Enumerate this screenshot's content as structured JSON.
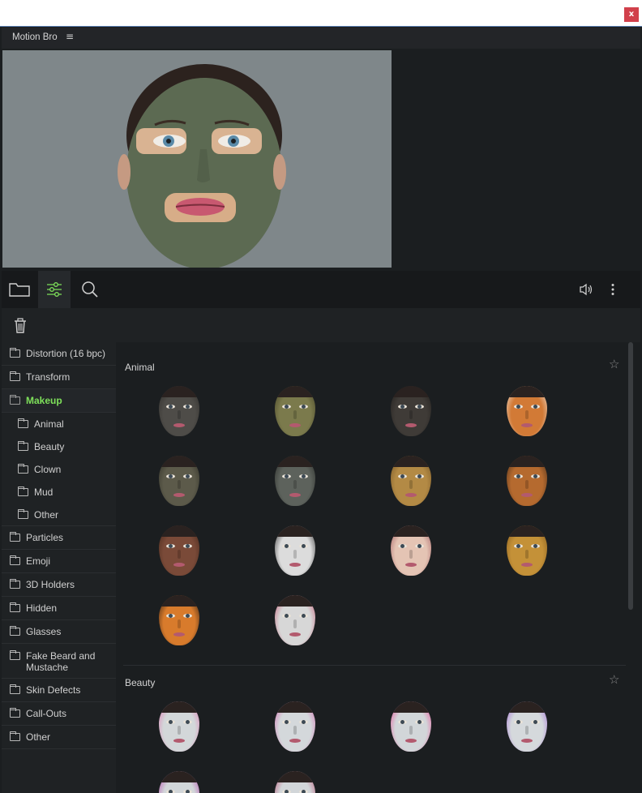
{
  "window": {
    "close_label": "x"
  },
  "panel": {
    "title": "Motion Bro",
    "menu_icon": "hamburger-icon"
  },
  "toolbar": {
    "icons": [
      "folder-icon",
      "sliders-icon",
      "search-icon",
      "speaker-icon",
      "more-vertical-icon"
    ]
  },
  "actionbar": {
    "icon": "trash-icon"
  },
  "sidebar": {
    "items": [
      {
        "label": "Distortion (16 bpc)"
      },
      {
        "label": "Transform"
      },
      {
        "label": "Makeup"
      },
      {
        "label": "Animal"
      },
      {
        "label": "Beauty"
      },
      {
        "label": "Clown"
      },
      {
        "label": "Mud"
      },
      {
        "label": "Other"
      },
      {
        "label": "Particles"
      },
      {
        "label": "Emoji"
      },
      {
        "label": "3D Holders"
      },
      {
        "label": "Hidden"
      },
      {
        "label": "Glasses"
      },
      {
        "label": "Fake Beard and Mustache"
      },
      {
        "label": "Skin Defects"
      },
      {
        "label": "Call-Outs"
      },
      {
        "label": "Other"
      }
    ]
  },
  "sections": [
    {
      "title": "Animal",
      "thumbs": [
        {
          "skin": "#4e4c48",
          "accent": "#2d2b28"
        },
        {
          "skin": "#7b7a4c",
          "accent": "#3f3c22"
        },
        {
          "skin": "#3f3b37",
          "accent": "#1e1b19"
        },
        {
          "skin": "#d27a36",
          "accent": "#f1ece6"
        },
        {
          "skin": "#5c5a4a",
          "accent": "#2a2a22"
        },
        {
          "skin": "#5d625c",
          "accent": "#232522"
        },
        {
          "skin": "#b38a45",
          "accent": "#6e4e20"
        },
        {
          "skin": "#b56a2f",
          "accent": "#3a2616"
        },
        {
          "skin": "#7a4a38",
          "accent": "#3e2418"
        },
        {
          "skin": "#dcdcdc",
          "accent": "#1c1c1c"
        },
        {
          "skin": "#e4c4b4",
          "accent": "#9a5058"
        },
        {
          "skin": "#c49138",
          "accent": "#7a5218"
        },
        {
          "skin": "#d87b2c",
          "accent": "#1d1410"
        },
        {
          "skin": "#d7d7d7",
          "accent": "#c24f6d"
        }
      ]
    },
    {
      "title": "Beauty",
      "thumbs": [
        {
          "skin": "#d3d7d9",
          "accent": "#e06fae"
        },
        {
          "skin": "#d4d8db",
          "accent": "#d55eab"
        },
        {
          "skin": "#d2d6d9",
          "accent": "#ec3e8f"
        },
        {
          "skin": "#d5d9dc",
          "accent": "#9b5fd6"
        },
        {
          "skin": "#d2d6d9",
          "accent": "#b03da8"
        },
        {
          "skin": "#d2d6d9",
          "accent": "#b5496c"
        }
      ]
    }
  ]
}
